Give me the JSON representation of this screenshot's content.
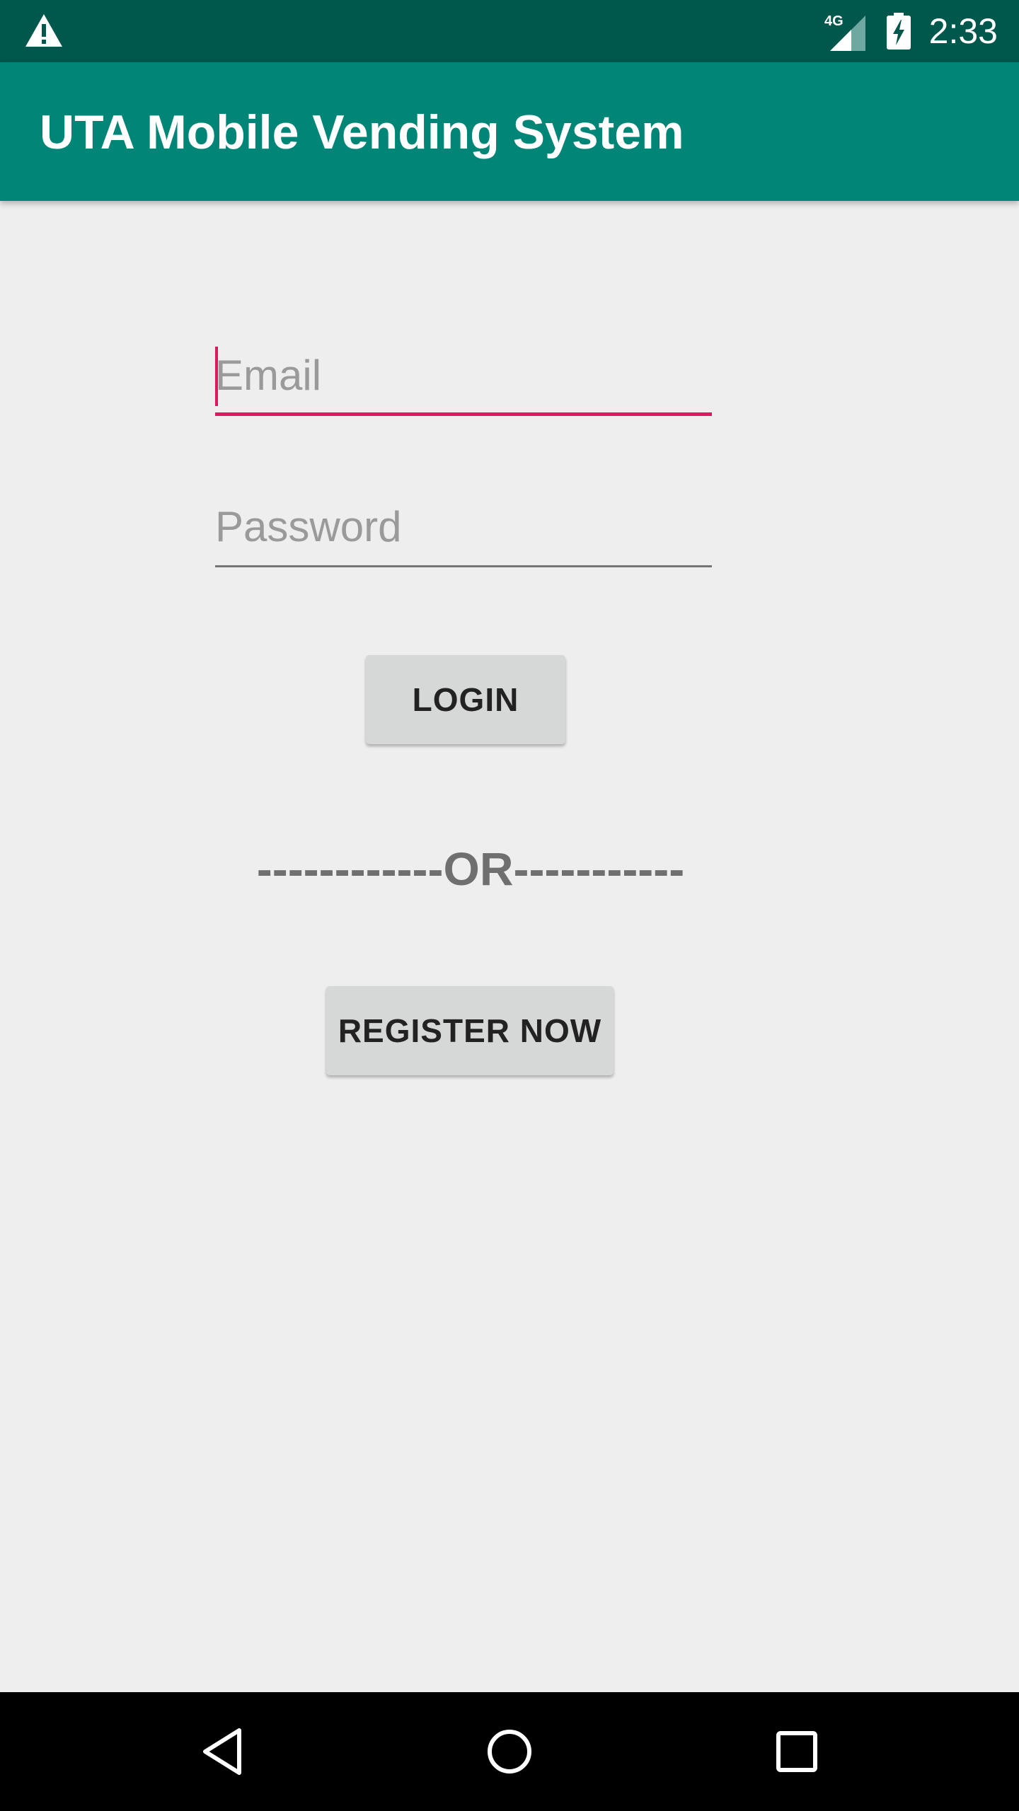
{
  "status_bar": {
    "network_label": "4G",
    "time": "2:33",
    "icons": [
      "warning-icon",
      "signal-icon",
      "battery-charging-icon"
    ]
  },
  "app_bar": {
    "title": "UTA Mobile Vending System"
  },
  "login_form": {
    "email_placeholder": "Email",
    "email_value": "",
    "password_placeholder": "Password",
    "password_value": "",
    "login_label": "LOGIN",
    "divider_text": "------------OR-----------",
    "register_label": "REGISTER NOW"
  },
  "navigation_bar": {
    "icons": [
      "back-icon",
      "home-icon",
      "recents-icon"
    ]
  },
  "colors": {
    "status_bar": "#00574b",
    "app_bar": "#008577",
    "accent": "#d81b60",
    "background": "#eeeeee",
    "button": "#d6d7d7"
  }
}
